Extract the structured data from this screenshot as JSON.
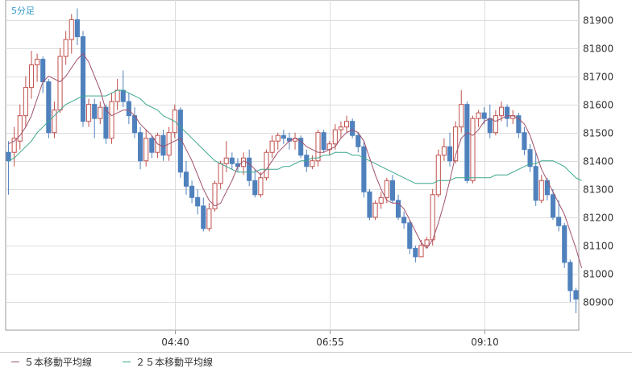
{
  "timeframe_label": "5分足",
  "legend": {
    "ma5_label": "５本移動平均線",
    "ma25_label": "２５本移動平均線"
  },
  "colors": {
    "up": "#c0504d",
    "down": "#4f81bd",
    "ma5": "#a0506a",
    "ma25": "#3aa68c",
    "grid": "#dddddd",
    "axis": "#999999",
    "text": "#333333"
  },
  "chart_data": {
    "type": "candlestick",
    "y_ticks": [
      81900,
      81800,
      81700,
      81600,
      81500,
      81400,
      81300,
      81200,
      81100,
      81000,
      80900
    ],
    "x_ticks": [
      {
        "label": "04:40",
        "index": 29
      },
      {
        "label": "06:55",
        "index": 56
      },
      {
        "label": "09:10",
        "index": 83
      }
    ],
    "ylim": [
      80800,
      81970
    ],
    "grid": true,
    "candles": [
      [
        81430,
        81470,
        81280,
        81400
      ],
      [
        81430,
        81520,
        81380,
        81480
      ],
      [
        81470,
        81600,
        81440,
        81560
      ],
      [
        81560,
        81700,
        81520,
        81660
      ],
      [
        81660,
        81790,
        81620,
        81740
      ],
      [
        81740,
        81780,
        81680,
        81760
      ],
      [
        81760,
        81770,
        81640,
        81680
      ],
      [
        81680,
        81690,
        81480,
        81500
      ],
      [
        81500,
        81610,
        81480,
        81580
      ],
      [
        81580,
        81800,
        81570,
        81770
      ],
      [
        81770,
        81860,
        81740,
        81830
      ],
      [
        81830,
        81920,
        81780,
        81900
      ],
      [
        81900,
        81940,
        81810,
        81840
      ],
      [
        81840,
        81860,
        81520,
        81540
      ],
      [
        81540,
        81620,
        81520,
        81600
      ],
      [
        81600,
        81620,
        81480,
        81550
      ],
      [
        81550,
        81610,
        81530,
        81590
      ],
      [
        81590,
        81600,
        81460,
        81480
      ],
      [
        81480,
        81640,
        81460,
        81610
      ],
      [
        81610,
        81690,
        81580,
        81650
      ],
      [
        81650,
        81720,
        81590,
        81610
      ],
      [
        81610,
        81640,
        81530,
        81560
      ],
      [
        81560,
        81590,
        81480,
        81500
      ],
      [
        81500,
        81520,
        81370,
        81400
      ],
      [
        81400,
        81510,
        81380,
        81480
      ],
      [
        81480,
        81490,
        81410,
        81430
      ],
      [
        81430,
        81500,
        81410,
        81490
      ],
      [
        81490,
        81510,
        81400,
        81420
      ],
      [
        81420,
        81520,
        81400,
        81500
      ],
      [
        81500,
        81600,
        81480,
        81580
      ],
      [
        81580,
        81590,
        81340,
        81360
      ],
      [
        81360,
        81400,
        81280,
        81310
      ],
      [
        81310,
        81330,
        81250,
        81270
      ],
      [
        81270,
        81300,
        81210,
        81240
      ],
      [
        81240,
        81270,
        81150,
        81160
      ],
      [
        81160,
        81250,
        81150,
        81230
      ],
      [
        81230,
        81330,
        81220,
        81320
      ],
      [
        81320,
        81400,
        81300,
        81390
      ],
      [
        81390,
        81470,
        81360,
        81410
      ],
      [
        81410,
        81430,
        81370,
        81390
      ],
      [
        81390,
        81410,
        81360,
        81380
      ],
      [
        81380,
        81430,
        81350,
        81410
      ],
      [
        81410,
        81440,
        81310,
        81330
      ],
      [
        81330,
        81370,
        81270,
        81280
      ],
      [
        81280,
        81360,
        81270,
        81340
      ],
      [
        81340,
        81440,
        81330,
        81430
      ],
      [
        81430,
        81490,
        81410,
        81470
      ],
      [
        81470,
        81500,
        81440,
        81490
      ],
      [
        81490,
        81510,
        81460,
        81480
      ],
      [
        81480,
        81500,
        81440,
        81470
      ],
      [
        81470,
        81500,
        81440,
        81480
      ],
      [
        81480,
        81490,
        81410,
        81420
      ],
      [
        81420,
        81440,
        81360,
        81380
      ],
      [
        81380,
        81420,
        81370,
        81400
      ],
      [
        81400,
        81510,
        81380,
        81500
      ],
      [
        81500,
        81510,
        81430,
        81440
      ],
      [
        81440,
        81470,
        81420,
        81460
      ],
      [
        81460,
        81530,
        81440,
        81510
      ],
      [
        81510,
        81540,
        81480,
        81520
      ],
      [
        81520,
        81560,
        81500,
        81540
      ],
      [
        81540,
        81550,
        81480,
        81490
      ],
      [
        81490,
        81500,
        81430,
        81450
      ],
      [
        81450,
        81470,
        81270,
        81290
      ],
      [
        81290,
        81300,
        81190,
        81200
      ],
      [
        81200,
        81260,
        81190,
        81250
      ],
      [
        81250,
        81290,
        81230,
        81270
      ],
      [
        81270,
        81340,
        81250,
        81330
      ],
      [
        81330,
        81350,
        81250,
        81260
      ],
      [
        81260,
        81280,
        81190,
        81200
      ],
      [
        81200,
        81220,
        81160,
        81180
      ],
      [
        81180,
        81190,
        81070,
        81090
      ],
      [
        81090,
        81100,
        81040,
        81060
      ],
      [
        81060,
        81120,
        81060,
        81100
      ],
      [
        81100,
        81130,
        81090,
        81120
      ],
      [
        81120,
        81300,
        81100,
        81280
      ],
      [
        81280,
        81440,
        81270,
        81420
      ],
      [
        81420,
        81480,
        81400,
        81450
      ],
      [
        81450,
        81500,
        81380,
        81400
      ],
      [
        81400,
        81540,
        81390,
        81520
      ],
      [
        81520,
        81650,
        81500,
        81600
      ],
      [
        81600,
        81610,
        81320,
        81330
      ],
      [
        81330,
        81560,
        81320,
        81550
      ],
      [
        81550,
        81580,
        81520,
        81570
      ],
      [
        81570,
        81590,
        81530,
        81550
      ],
      [
        81550,
        81600,
        81480,
        81500
      ],
      [
        81500,
        81580,
        81490,
        81560
      ],
      [
        81560,
        81610,
        81540,
        81590
      ],
      [
        81590,
        81600,
        81520,
        81550
      ],
      [
        81550,
        81580,
        81530,
        81560
      ],
      [
        81560,
        81570,
        81480,
        81500
      ],
      [
        81500,
        81520,
        81420,
        81440
      ],
      [
        81440,
        81460,
        81360,
        81380
      ],
      [
        81380,
        81430,
        81240,
        81260
      ],
      [
        81260,
        81350,
        81250,
        81330
      ],
      [
        81330,
        81340,
        81260,
        81280
      ],
      [
        81280,
        81300,
        81190,
        81200
      ],
      [
        81200,
        81260,
        81150,
        81170
      ],
      [
        81170,
        81180,
        81020,
        81040
      ],
      [
        81040,
        81050,
        80900,
        80940
      ],
      [
        80940,
        80950,
        80860,
        80910
      ]
    ],
    "ma5": [
      81460,
      81470,
      81490,
      81520,
      81560,
      81620,
      81680,
      81700,
      81690,
      81680,
      81700,
      81730,
      81760,
      81780,
      81750,
      81700,
      81650,
      81580,
      81560,
      81570,
      81580,
      81580,
      81560,
      81530,
      81510,
      81490,
      81460,
      81450,
      81460,
      81470,
      81480,
      81440,
      81400,
      81350,
      81300,
      81260,
      81240,
      81250,
      81290,
      81330,
      81380,
      81400,
      81390,
      81370,
      81350,
      81370,
      81400,
      81430,
      81450,
      81470,
      81480,
      81470,
      81450,
      81440,
      81430,
      81430,
      81440,
      81450,
      81480,
      81500,
      81510,
      81500,
      81470,
      81410,
      81350,
      81300,
      81260,
      81250,
      81250,
      81230,
      81190,
      81150,
      81110,
      81090,
      81120,
      81180,
      81250,
      81330,
      81420,
      81480,
      81500,
      81490,
      81510,
      81540,
      81550,
      81540,
      81550,
      81560,
      81560,
      81550,
      81530,
      81490,
      81430,
      81370,
      81330,
      81290,
      81250,
      81210,
      81150,
      81090,
      81020
    ],
    "ma25": [
      81400,
      81410,
      81430,
      81450,
      81470,
      81500,
      81520,
      81540,
      81560,
      81580,
      81600,
      81610,
      81620,
      81630,
      81630,
      81630,
      81630,
      81630,
      81640,
      81650,
      81650,
      81640,
      81630,
      81620,
      81600,
      81590,
      81580,
      81560,
      81550,
      81540,
      81520,
      81500,
      81480,
      81460,
      81440,
      81420,
      81400,
      81390,
      81380,
      81370,
      81360,
      81360,
      81360,
      81360,
      81370,
      81370,
      81370,
      81370,
      81380,
      81380,
      81390,
      81400,
      81400,
      81410,
      81410,
      81420,
      81420,
      81430,
      81430,
      81430,
      81420,
      81420,
      81410,
      81400,
      81390,
      81380,
      81370,
      81360,
      81350,
      81340,
      81330,
      81320,
      81320,
      81320,
      81320,
      81330,
      81330,
      81330,
      81340,
      81340,
      81340,
      81340,
      81340,
      81340,
      81340,
      81350,
      81350,
      81350,
      81360,
      81370,
      81380,
      81390,
      81390,
      81400,
      81400,
      81400,
      81390,
      81380,
      81360,
      81340,
      81330
    ]
  }
}
